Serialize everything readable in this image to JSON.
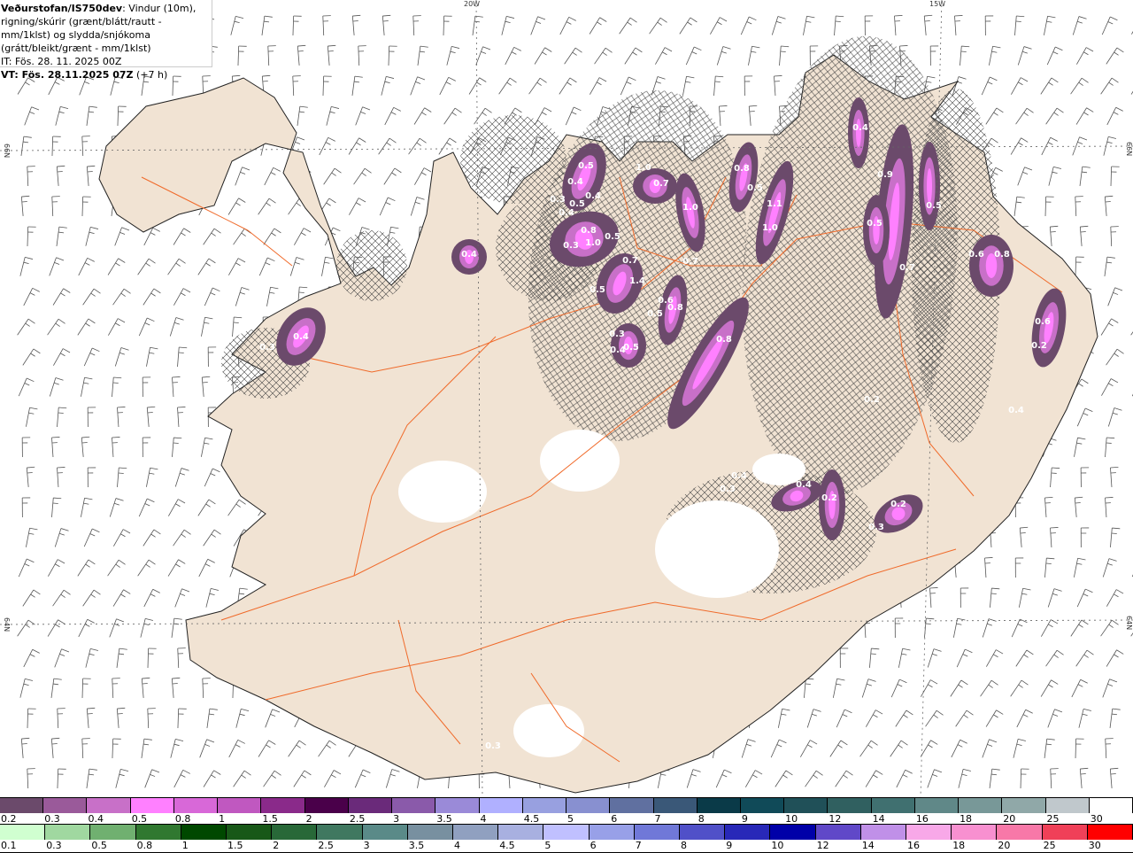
{
  "header": {
    "source": "Veðurstofan/IS750dev",
    "description": ": Vindur (10m), rigning/skúrir (grænt/blátt/rautt - mm/1klst) og slydda/snjókoma (grátt/bleikt/grænt - mm/1klst)",
    "initial_time": "IT: Fös. 28. 11. 2025 00Z",
    "valid_time": "VT: Fös. 28.11.2025 07Z",
    "lead": " (+7 h)"
  },
  "grid_labels": {
    "lon_20": "20W",
    "lon_15": "15W",
    "lat_66_left": "66N",
    "lat_64_left": "64N",
    "lat_66_right": "66N",
    "lat_64_right": "64N"
  },
  "colors": {
    "land": "#f1e3d3",
    "roads": "#f06a2a",
    "coast": "#222222",
    "barbs": "#555555"
  },
  "precip_labels": [
    "0.5",
    "0.4",
    "0.3",
    "0.5",
    "0.4",
    "0.4",
    "0.8",
    "1.0",
    "0.3",
    "0.5",
    "0.7",
    "1.4",
    "0.5",
    "0.3",
    "0.4",
    "0.5",
    "1.0",
    "0.7",
    "1.0",
    "0.7",
    "0.6",
    "0.8",
    "0.5",
    "0.8",
    "0.5",
    "1.1",
    "1.0",
    "0.8",
    "0.4",
    "0.4",
    "0.3",
    "0.9",
    "0.5",
    "0.5",
    "0.7",
    "0.4",
    "0.6",
    "0.8",
    "0.6",
    "0.2",
    "0.2",
    "0.3",
    "0.4",
    "0.4",
    "0.2",
    "0.2",
    "0.3",
    "0.4",
    "0.3"
  ],
  "legend_snow": {
    "colors": [
      "#6b4a6b",
      "#9a5a9a",
      "#c870c8",
      "#ff80ff",
      "#d868d8",
      "#c058c0",
      "#8a2a8a",
      "#4a004a",
      "#6a2a7a",
      "#8a5aaa",
      "#9a8ad8",
      "#b0b0ff",
      "#98a0e0",
      "#8890d0",
      "#6070a0",
      "#3a5878",
      "#0a3a48",
      "#104a58",
      "#205058",
      "#306060",
      "#407070",
      "#608888",
      "#789898",
      "#90a8a8",
      "#c0c8cc",
      "#ffffff"
    ],
    "labels": [
      "0.2",
      "0.3",
      "0.4",
      "0.5",
      "0.8",
      "1",
      "1.5",
      "2",
      "2.5",
      "3",
      "3.5",
      "4",
      "4.5",
      "5",
      "6",
      "7",
      "8",
      "9",
      "10",
      "12",
      "14",
      "16",
      "18",
      "20",
      "25",
      "30"
    ]
  },
  "legend_rain": {
    "colors": [
      "#d0ffd0",
      "#a0d8a0",
      "#70b070",
      "#307830",
      "#004800",
      "#185818",
      "#286838",
      "#407860",
      "#5a8a88",
      "#7890a0",
      "#90a0c0",
      "#a8b0e0",
      "#c0c0ff",
      "#98a0e8",
      "#7078d8",
      "#5050c8",
      "#2828b8",
      "#0000a8",
      "#6048c8",
      "#c090e8",
      "#f8a8e8",
      "#f890d0",
      "#f878a8",
      "#f04058",
      "#ff0000"
    ],
    "labels": [
      "0.1",
      "0.3",
      "0.5",
      "0.8",
      "1",
      "1.5",
      "2",
      "2.5",
      "3",
      "3.5",
      "4",
      "4.5",
      "5",
      "6",
      "7",
      "8",
      "9",
      "10",
      "12",
      "14",
      "16",
      "18",
      "20",
      "25",
      "30"
    ]
  }
}
